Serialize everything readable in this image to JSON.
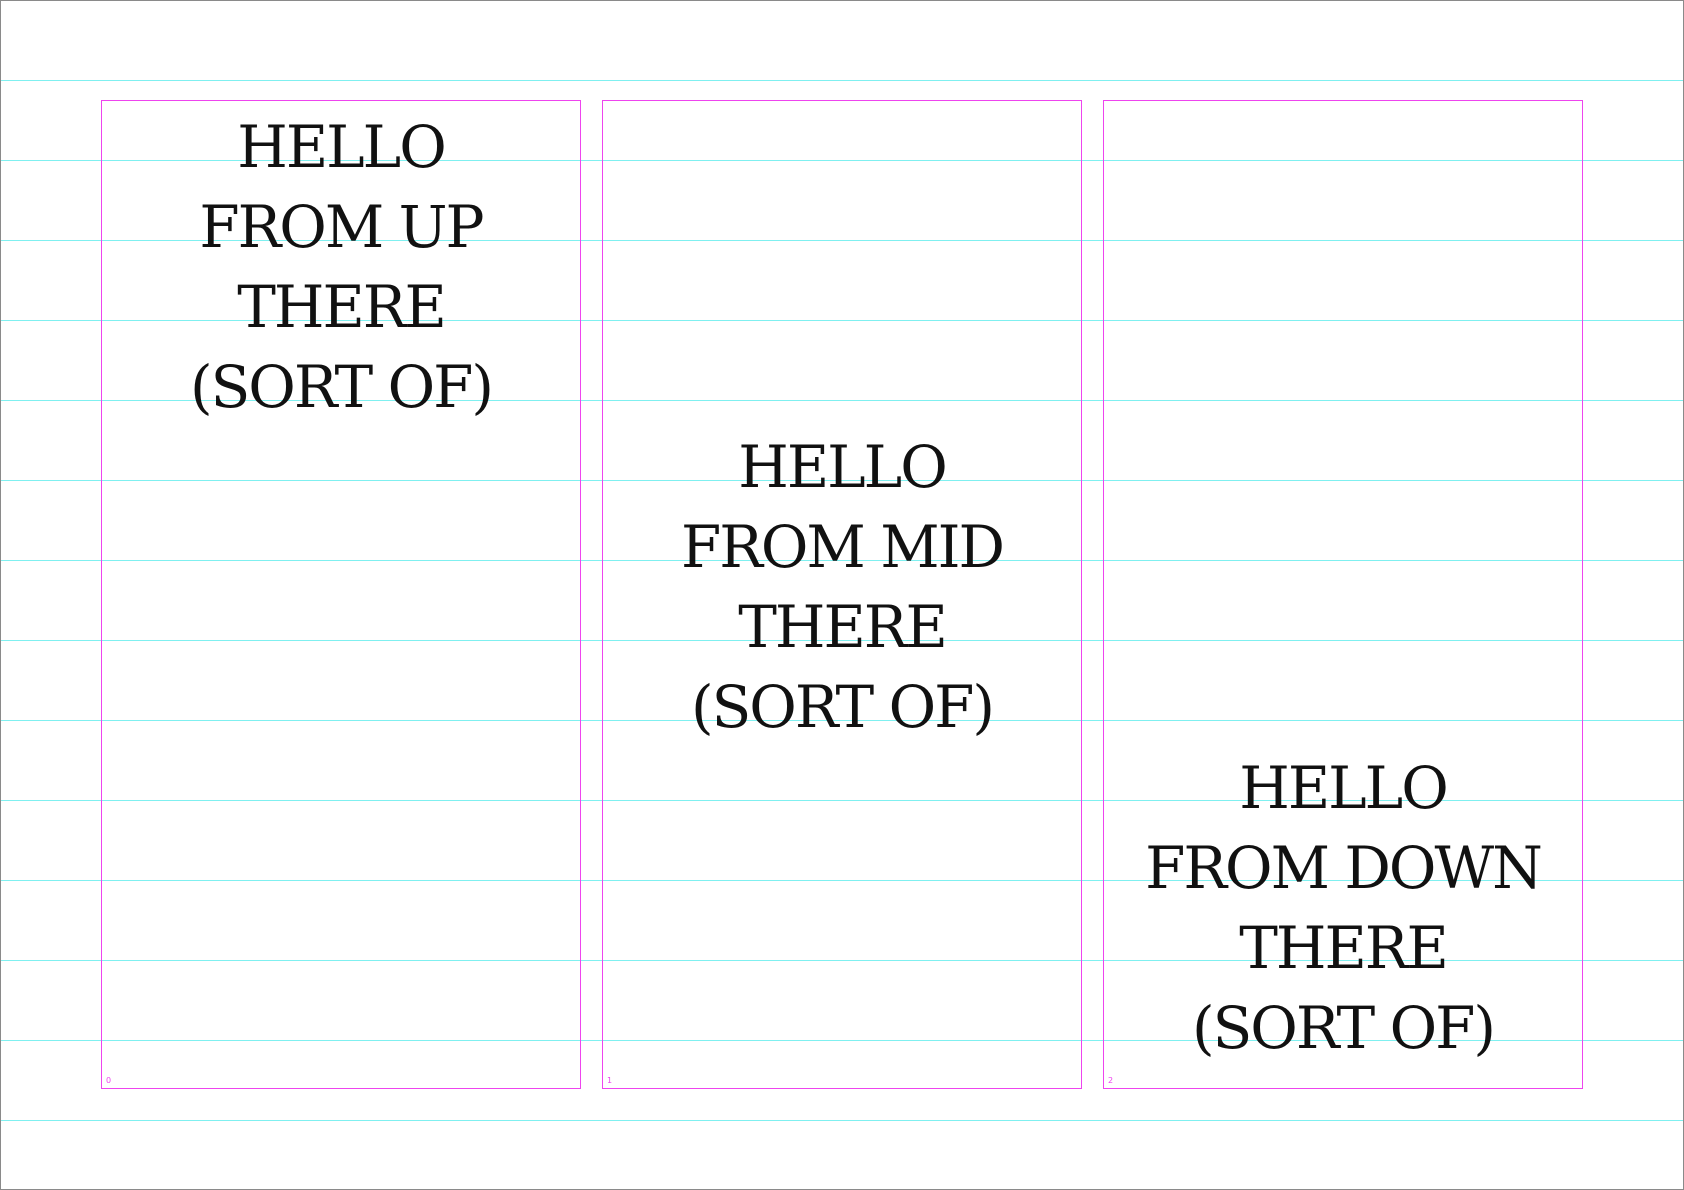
{
  "guide_color": "#7ff0f0",
  "frame_color": "#ee44ee",
  "text_color": "#111111",
  "frames": [
    {
      "index": "0",
      "lines": [
        "HELLO",
        "FROM UP",
        "THERE",
        "(SORT OF)"
      ]
    },
    {
      "index": "1",
      "lines": [
        "HELLO",
        "FROM MID",
        "THERE",
        "(SORT OF)"
      ]
    },
    {
      "index": "2",
      "lines": [
        "HELLO",
        "FROM DOWN",
        "THERE",
        "(SORT OF)"
      ]
    }
  ]
}
